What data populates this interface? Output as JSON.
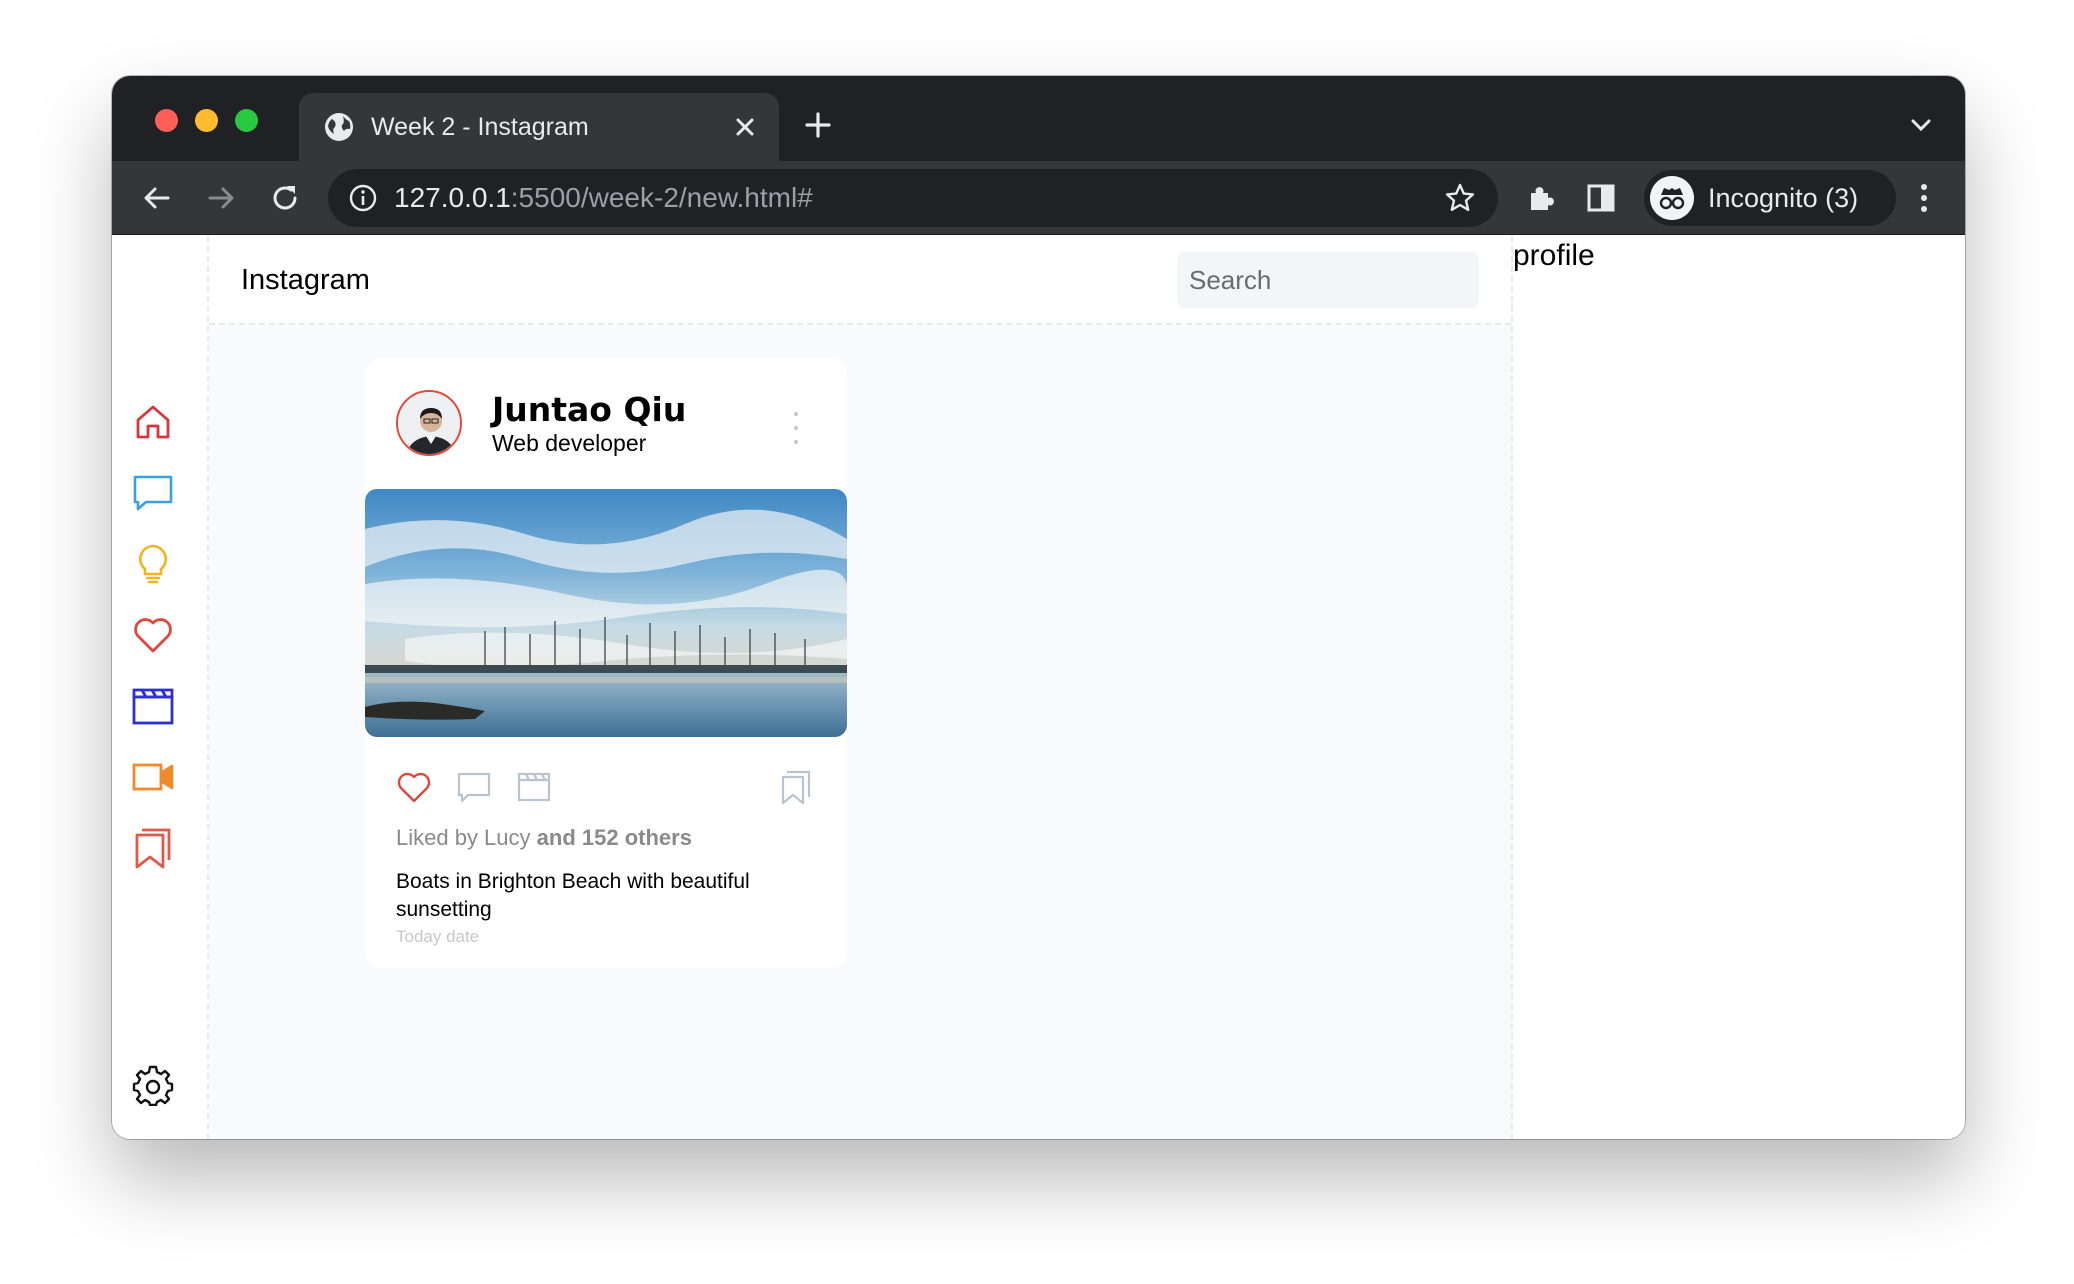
{
  "browser": {
    "tab_title": "Week 2 - Instagram",
    "url_host": "127.0.0.1",
    "url_rest": ":5500/week-2/new.html#",
    "profile_label": "Incognito (3)"
  },
  "app": {
    "brand": "Instagram",
    "search_placeholder": "Search",
    "profile_heading": "profile",
    "sidebar_icons": [
      "home-icon",
      "message-icon",
      "lightbulb-icon",
      "heart-icon",
      "clapperboard-icon",
      "video-camera-icon",
      "bookmark-icon",
      "gear-icon"
    ],
    "colors": {
      "home": "#d9353f",
      "message": "#3aa0e6",
      "lightbulb": "#f2b51c",
      "heart": "#e0463a",
      "clapperboard": "#2b2fd6",
      "video": "#f08a2c",
      "bookmark": "#e05a4a"
    }
  },
  "post": {
    "author": "Juntao Qiu",
    "role": "Web developer",
    "liked_prefix": "Liked by Lucy",
    "liked_suffix": "and 152 others",
    "caption": "Boats in Brighton Beach with beautiful sunsetting",
    "date": "Today date"
  }
}
